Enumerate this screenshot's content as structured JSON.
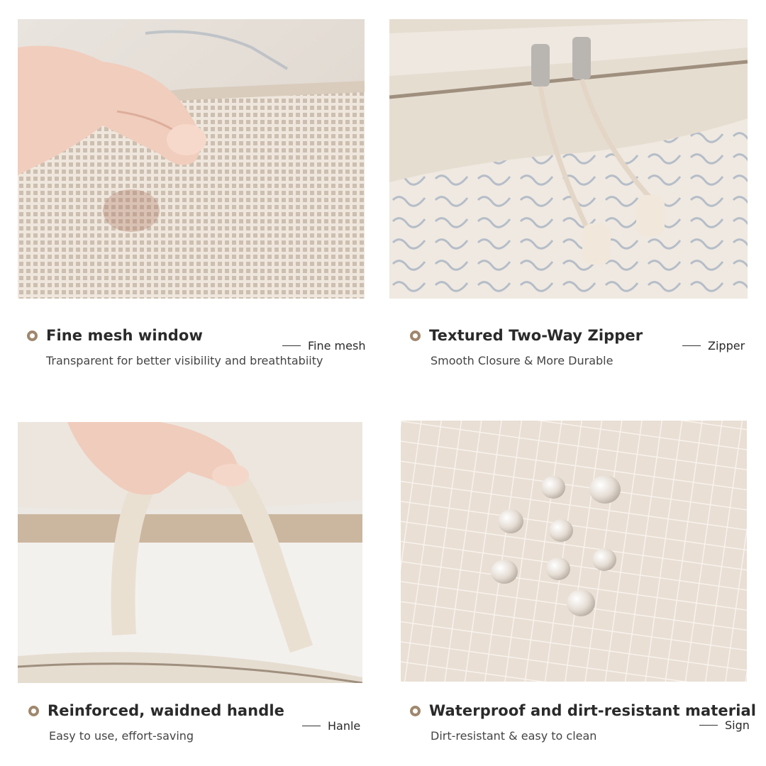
{
  "colors": {
    "accent_ring": "#a0876d",
    "fabric": "#e8ded2",
    "background": "#ffffff"
  },
  "features": {
    "mesh": {
      "title": "Fine mesh window",
      "subtitle": "Transparent for better visibility and breathtabiity",
      "tag": "Fine mesh",
      "icon": "circle-bullet-icon"
    },
    "zipper": {
      "title": "Textured Two-Way Zipper",
      "subtitle": "Smooth Closure & More Durable",
      "tag": "Zipper",
      "icon": "circle-bullet-icon"
    },
    "handle": {
      "title": "Reinforced, waidned handle",
      "subtitle": "Easy to use, effort-saving",
      "tag": "Hanle",
      "icon": "circle-bullet-icon"
    },
    "water": {
      "title": "Waterproof and dirt-resistant material",
      "subtitle": "Dirt-resistant & easy to clean",
      "tag": "Sign",
      "icon": "circle-bullet-icon"
    }
  }
}
